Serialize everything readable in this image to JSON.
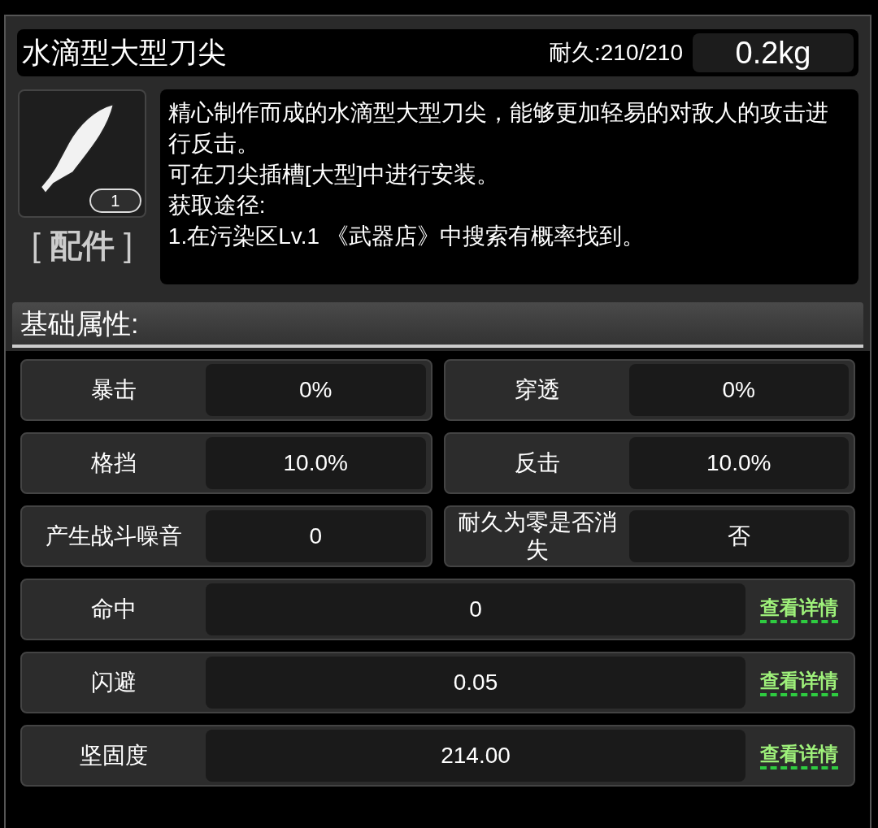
{
  "item": {
    "name": "水滴型大型刀尖",
    "durability": "耐久:210/210",
    "weight": "0.2kg",
    "count": "1",
    "category": "[ **配件** ]"
  },
  "description": [
    "精心制作而成的水滴型大型刀尖，能够更加轻易的对敌人的攻击进行反击。",
    "可在刀尖插槽[大型]中进行安装。",
    "获取途径:",
    "1.在污染区Lv.1 《武器店》中搜索有概率找到。"
  ],
  "section_title": "基础属性:",
  "stats": [
    {
      "kind": "half",
      "label": "暴击",
      "value": "0%"
    },
    {
      "kind": "half",
      "label": "穿透",
      "value": "0%"
    },
    {
      "kind": "half",
      "label": "格挡",
      "value": "10.0%"
    },
    {
      "kind": "half",
      "label": "反击",
      "value": "10.0%"
    },
    {
      "kind": "half",
      "label": "产生战斗噪音",
      "value": "0"
    },
    {
      "kind": "half",
      "label": "耐久为零是否消失",
      "value": "否"
    },
    {
      "kind": "wide",
      "label": "命中",
      "value": "0",
      "link": "查看详情"
    },
    {
      "kind": "wide",
      "label": "闪避",
      "value": "0.05",
      "link": "查看详情"
    },
    {
      "kind": "wide",
      "label": "坚固度",
      "value": "214.00",
      "link": "查看详情"
    }
  ]
}
